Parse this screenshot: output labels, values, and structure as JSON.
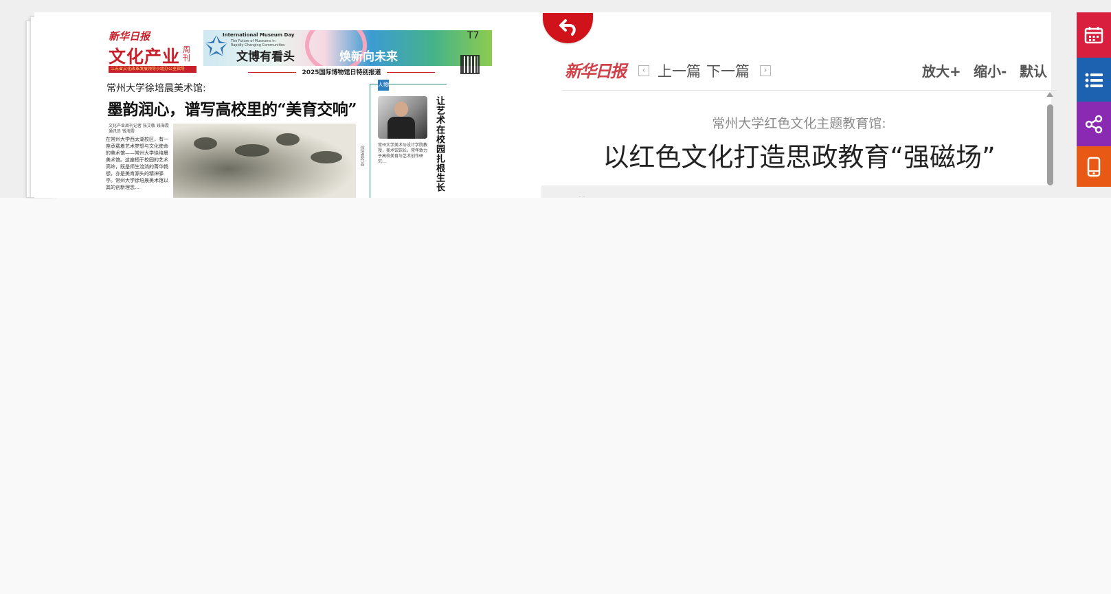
{
  "newspaper": {
    "logo": "新华日报",
    "section": "文化产业",
    "weekly": "周刊",
    "red_bar": "江苏省文化改革发展领导小组办公室指导",
    "banner": {
      "museum_en": "International Museum Day",
      "museum_sub": "The Future of Museums in Rapidly Changing Communities",
      "slogan_left": "文博有看头",
      "slogan_right": "焕新向未来"
    },
    "page_no": "T7",
    "special_report": "2025国际博物馆日特别报道",
    "kicker": "常州大学徐培晨美术馆:",
    "headline": "墨韵润心，谱写高校里的“美育交响”",
    "byline": "文化产业周刊记者 张艾敬 钱海霞 通讯员 钱海霞",
    "body": "在常州大学西太湖校区，有一座承载着艺术梦想与文化使命的美术馆——常州大学徐培晨美术馆。这座栖于校园的艺术高岭，既是师生流淌的菁华畅想，亦是美育源头的精神驿亭。常州大学徐培晨美术馆以其的创新理念…",
    "painting_caption": "徐培晨作品",
    "sidebar_tag": "人物",
    "sidebar_body": "常州大学美术与设计学院教授，美术馆馆长，常年致力于高校美育与艺术创作研究…",
    "sidebar_title": "让艺术在校园扎根生长"
  },
  "article": {
    "logo": "新华日报",
    "prev": "上一篇",
    "next": "下一篇",
    "zoom_in": "放大+",
    "zoom_out": "缩小-",
    "default": "默认",
    "subtitle": "常州大学红色文化主题教育馆:",
    "title": "以红色文化打造思政教育“强磁场”"
  },
  "icons": {
    "back": "back-arrow-icon",
    "calendar": "calendar-icon",
    "list": "list-icon",
    "share": "share-icon",
    "mobile": "mobile-icon"
  },
  "colors": {
    "brand_red": "#d0121b",
    "calendar_bg": "#d81f3d",
    "list_bg": "#1c62b1",
    "share_bg": "#8a2ab3",
    "mobile_bg": "#e85915"
  }
}
